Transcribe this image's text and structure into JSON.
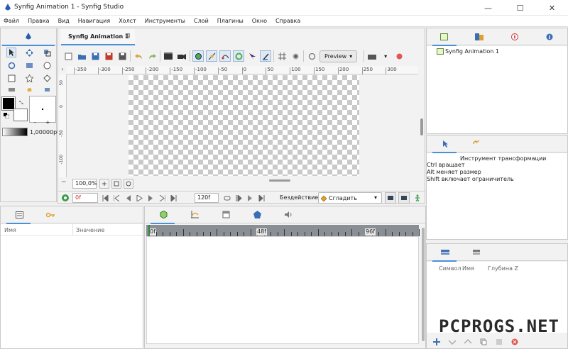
{
  "window": {
    "title": "Synfig Animation 1 - Synfig Studio",
    "minimize": "—",
    "maximize": "☐",
    "close": "✕"
  },
  "menu": [
    "Файл",
    "Правка",
    "Вид",
    "Навигация",
    "Холст",
    "Инструменты",
    "Слой",
    "Плагины",
    "Окно",
    "Справка"
  ],
  "canvas_tab": {
    "title": "Synfig Animation 1",
    "close": "⊠"
  },
  "toolbar": {
    "preview_label": "Preview"
  },
  "ruler": {
    "h_labels": [
      "-350",
      "-300",
      "-250",
      "-200",
      "-150",
      "-100",
      "-50",
      "0",
      "50",
      "100",
      "150",
      "200",
      "250",
      "300"
    ],
    "v_labels": [
      "50",
      "0",
      "-50",
      "-100"
    ]
  },
  "brush": {
    "size": "1,00000pt",
    "minus": "-",
    "plus": "+"
  },
  "bottom_controls": {
    "zoom": "100,0%",
    "current_time": "0f",
    "end_time": "120f",
    "keyframe_lock": "Бездействие",
    "interpolation": "Сгладить"
  },
  "params": {
    "col_name": "Имя",
    "col_value": "Значение"
  },
  "timetrack": {
    "marks": [
      "0f",
      "48f",
      "96f"
    ]
  },
  "canvas_browser": {
    "item": "Synfig Animation 1"
  },
  "tool_options": {
    "title": "Инструмент трансформации",
    "lines": [
      "Ctrl вращает",
      "Alt меняет размер",
      "Shift включает ограничитель"
    ]
  },
  "library": {
    "col_symbol": "Символ",
    "col_name": "Имя",
    "col_depth": "Глубина Z"
  },
  "watermark": "PCPROGS.NET",
  "colors": {
    "accent": "#4a90d9",
    "timebar": "#8a8f96",
    "playhead": "#2e8b3a"
  }
}
